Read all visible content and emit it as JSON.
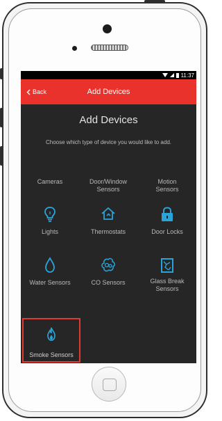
{
  "status_bar": {
    "time": "11:37"
  },
  "app_bar": {
    "back_label": "Back",
    "title": "Add Devices"
  },
  "main": {
    "heading": "Add Devices",
    "subtitle": "Choose which type of device you would like to add."
  },
  "devices": [
    {
      "label": "Cameras",
      "icon": "camera-icon"
    },
    {
      "label": "Door/Window Sensors",
      "icon": "door-window-icon"
    },
    {
      "label": "Motion Sensors",
      "icon": "motion-icon"
    },
    {
      "label": "Lights",
      "icon": "lightbulb-icon"
    },
    {
      "label": "Thermostats",
      "icon": "home-thermostat-icon"
    },
    {
      "label": "Door Locks",
      "icon": "lock-icon"
    },
    {
      "label": "Water Sensors",
      "icon": "water-drop-icon"
    },
    {
      "label": "CO Sensors",
      "icon": "co-gas-icon"
    },
    {
      "label": "Glass Break Sensors",
      "icon": "glass-break-icon"
    },
    {
      "label": "Smoke Sensors",
      "icon": "flame-icon"
    }
  ],
  "colors": {
    "accent": "#e8322b",
    "icon": "#2aa4d8",
    "selected_border": "#e03a33"
  }
}
